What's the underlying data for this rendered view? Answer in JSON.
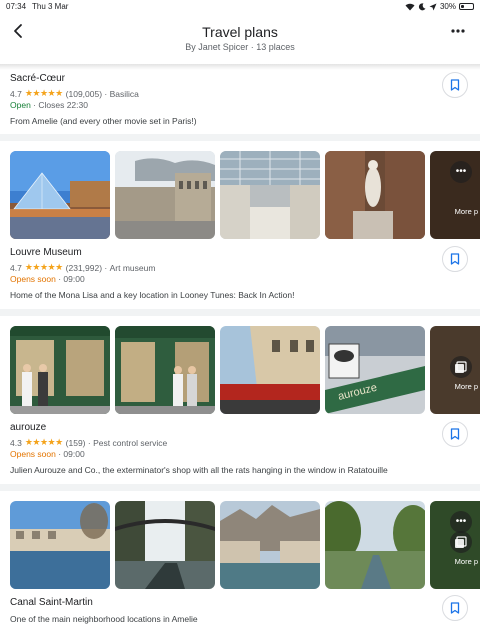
{
  "status_bar": {
    "time": "07:34",
    "date": "Thu 3 Mar",
    "battery": "30%",
    "battery_level": 0.3
  },
  "header": {
    "title": "Travel plans",
    "subtitle": "By Janet Spicer · 13 places"
  },
  "places": [
    {
      "name": "Sacré-Cœur",
      "rating": "4.7",
      "reviews": "(109,005)",
      "category": "Basilica",
      "status": "Open",
      "hours": "Closes 22:30",
      "note": "From Amelie (and every other movie set in Paris!)"
    },
    {
      "name": "Louvre Museum",
      "rating": "4.7",
      "reviews": "(231,992)",
      "category": "Art museum",
      "status": "Opens soon",
      "hours": "09:00",
      "note": "Home of the Mona Lisa and a key location in Looney Tunes: Back In Action!",
      "more_label": "More p"
    },
    {
      "name": "aurouze",
      "rating": "4.3",
      "reviews": "(159)",
      "category": "Pest control service",
      "status": "Opens soon",
      "hours": "09:00",
      "note": "Julien Aurouze and Co., the exterminator's shop with all the rats hanging in the window in Ratatouille",
      "more_label": "More p",
      "shop_sign": "aurouze"
    },
    {
      "name": "Canal Saint-Martin",
      "note": "One of the main neighborhood locations in Amelie",
      "more_label": "More p"
    }
  ],
  "colors": {
    "star": "#f4a31b",
    "open": "#188038",
    "opens_soon": "#e37400",
    "accent": "#1a73e8"
  }
}
